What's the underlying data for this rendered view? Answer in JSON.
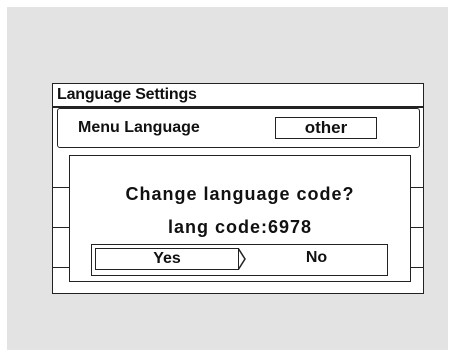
{
  "screen": {
    "title": "Language Settings",
    "menu_language": {
      "label": "Menu Language",
      "value": "other"
    }
  },
  "dialog": {
    "question": "Change language code?",
    "code_text": "lang code:6978",
    "buttons": {
      "yes": "Yes",
      "no": "No"
    }
  }
}
